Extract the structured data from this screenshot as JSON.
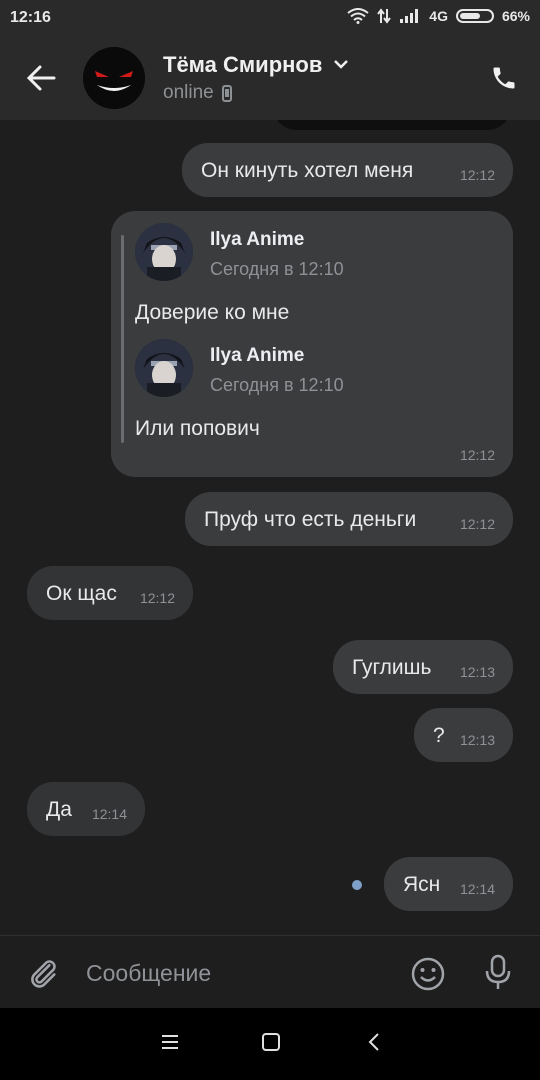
{
  "status_bar": {
    "time": "12:16",
    "network": "4G",
    "battery": "66%",
    "battery_level": 0.66
  },
  "header": {
    "name": "Тёма Смирнов",
    "status": "online"
  },
  "messages": [
    {
      "text": "Он кинуть хотел меня",
      "time": "12:12",
      "direction": "out"
    },
    {
      "text": "Пруф что есть деньги",
      "time": "12:12",
      "direction": "out"
    },
    {
      "text": "Ок щас",
      "time": "12:12",
      "direction": "in"
    },
    {
      "text": "Гуглишь",
      "time": "12:13",
      "direction": "out"
    },
    {
      "text": "?",
      "time": "12:13",
      "direction": "out"
    },
    {
      "text": "Да",
      "time": "12:14",
      "direction": "in"
    },
    {
      "text": "Ясн",
      "time": "12:14",
      "direction": "out",
      "unread": true
    }
  ],
  "forwarded": {
    "time": "12:12",
    "items": [
      {
        "author": "Ilya Anime",
        "date": "Сегодня в 12:10",
        "text": "Доверие ко мне"
      },
      {
        "author": "Ilya Anime",
        "date": "Сегодня в 12:10",
        "text": "Или попович"
      }
    ]
  },
  "composer": {
    "placeholder": "Сообщение"
  },
  "colors": {
    "background": "#1e1e1f",
    "bubble_out": "#3b3c3e",
    "bubble_in": "#333436",
    "unread_dot": "#7ea0c9"
  }
}
